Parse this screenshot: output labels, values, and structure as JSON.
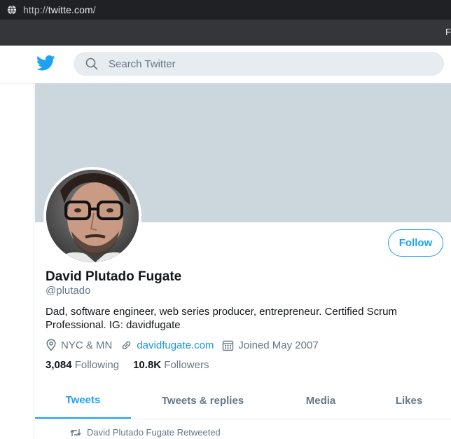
{
  "browser": {
    "url_prefix": "http://",
    "url_host": "twitte.com",
    "url_suffix": "/",
    "bookmarks_bar_cut_text": "F"
  },
  "header": {
    "logo_icon": "twitter-bird-icon",
    "search_placeholder": "Search Twitter"
  },
  "profile": {
    "avatar_icon": "profile-photo",
    "follow_label": "Follow",
    "display_name": "David Plutado Fugate",
    "handle": "@plutado",
    "bio": "Dad, software engineer, web series producer, entrepreneur. Certified Scrum Professional. IG: davidfugate",
    "location": "NYC & MN",
    "website": "davidfugate.com",
    "joined": "Joined May 2007",
    "following_count": "3,084",
    "following_label": "Following",
    "followers_count": "10.8K",
    "followers_label": "Followers"
  },
  "tabs": [
    {
      "label": "Tweets",
      "active": true
    },
    {
      "label": "Tweets & replies",
      "active": false
    },
    {
      "label": "Media",
      "active": false
    },
    {
      "label": "Likes",
      "active": false
    }
  ],
  "timeline": {
    "retweet_note": "David Plutado Fugate Retweeted"
  },
  "colors": {
    "accent": "#1da1f2",
    "link": "#1b95e0",
    "banner": "#ccd6dd",
    "secondary_text": "#657786"
  }
}
